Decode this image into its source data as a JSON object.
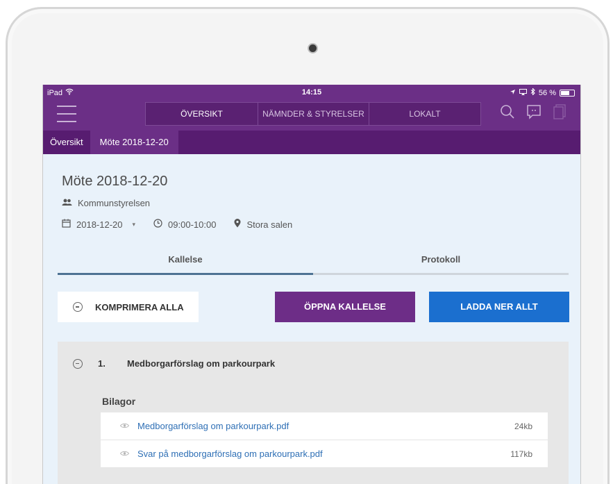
{
  "status": {
    "carrier": "iPad",
    "time": "14:15",
    "battery": "56 %"
  },
  "nav": {
    "tabs": [
      {
        "label": "ÖVERSIKT",
        "active": true
      },
      {
        "label": "NÄMNDER & STYRELSER",
        "active": false
      },
      {
        "label": "LOKALT",
        "active": false
      }
    ]
  },
  "breadcrumb": [
    "Översikt",
    "Möte 2018-12-20"
  ],
  "meeting": {
    "title": "Möte 2018-12-20",
    "committee": "Kommunstyrelsen",
    "date": "2018-12-20",
    "time": "09:00-10:00",
    "location": "Stora salen"
  },
  "tabs": [
    {
      "label": "Kallelse",
      "active": true
    },
    {
      "label": "Protokoll",
      "active": false
    }
  ],
  "actions": {
    "collapse_all": "KOMPRIMERA ALLA",
    "open_notice": "ÖPPNA KALLELSE",
    "download_all": "LADDA NER ALLT"
  },
  "colors": {
    "purple": "#6b2f86",
    "blue": "#1b6fcf"
  },
  "agenda": {
    "number": "1.",
    "title": "Medborgarförslag om parkourpark",
    "attachments_label": "Bilagor",
    "attachments": [
      {
        "name": "Medborgarförslag om parkourpark.pdf",
        "size": "24kb"
      },
      {
        "name": "Svar på medborgarförslag om parkourpark.pdf",
        "size": "117kb"
      }
    ]
  }
}
